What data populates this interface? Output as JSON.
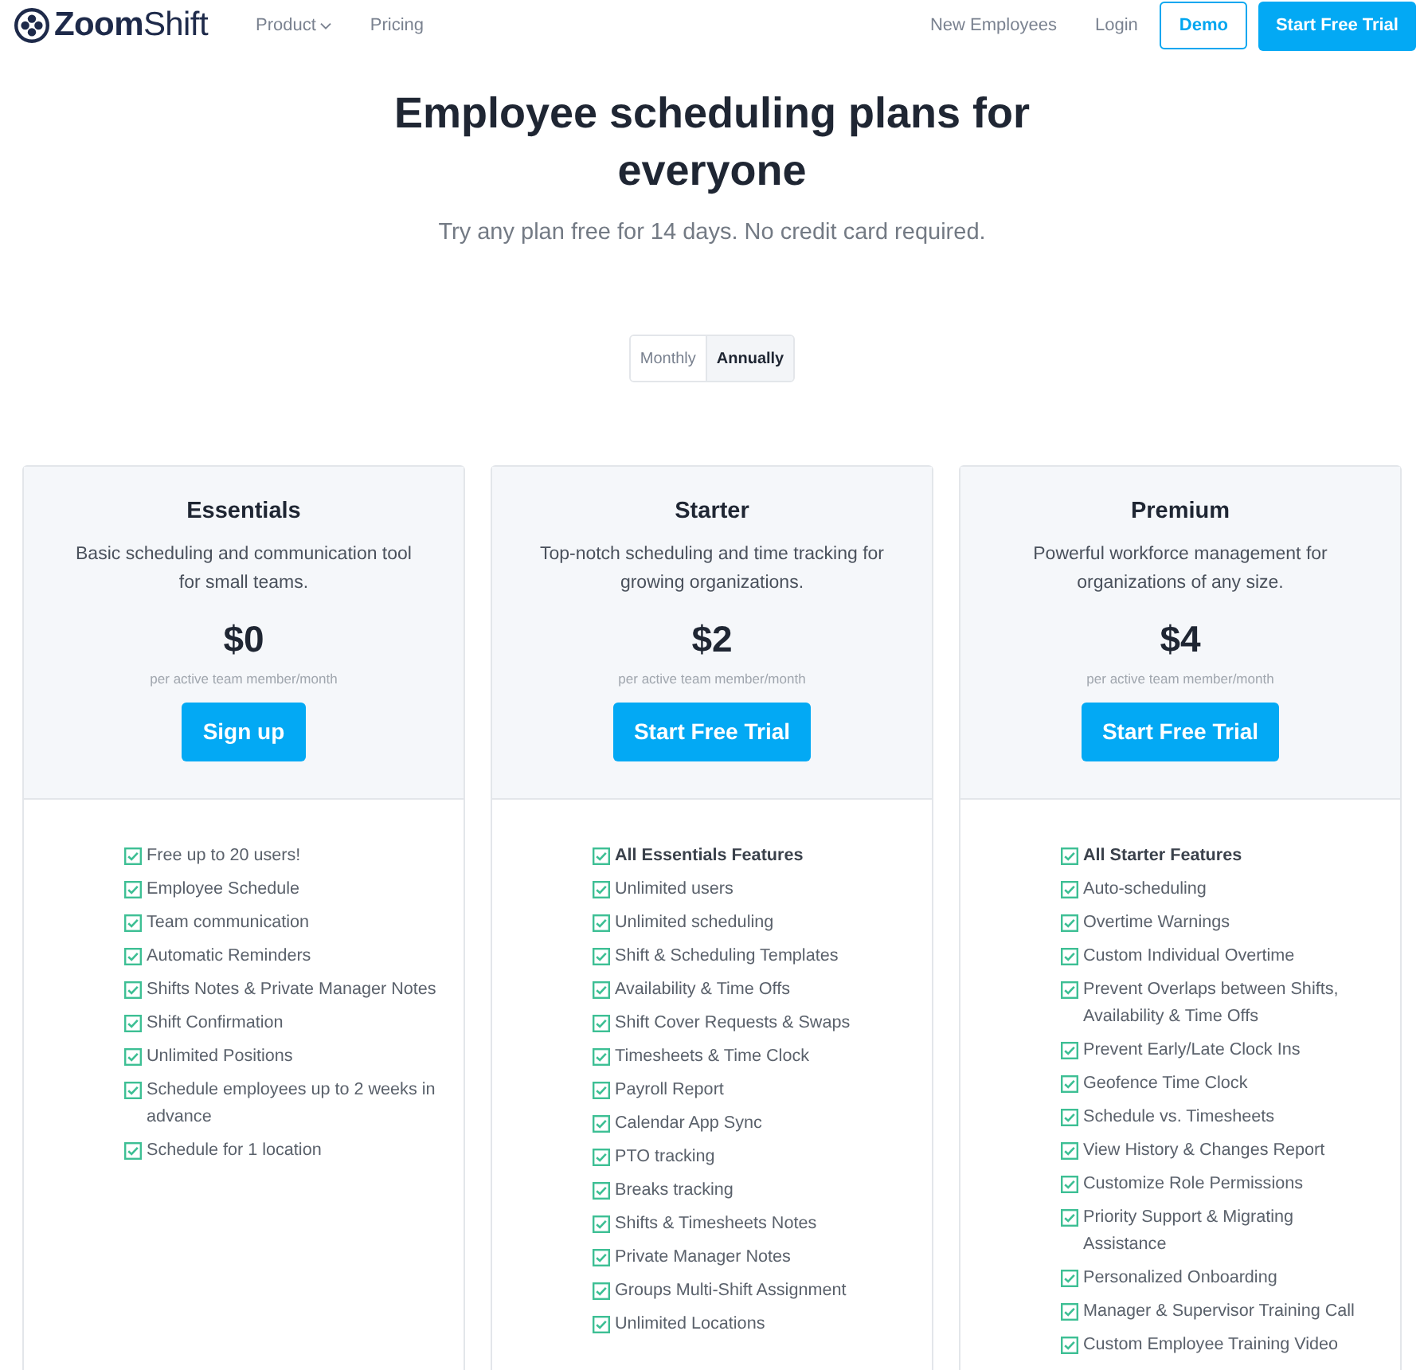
{
  "nav": {
    "logo": "**Zoom**Shift",
    "links": [
      {
        "label": "Product",
        "kind": "dropdown"
      },
      {
        "label": "Pricing",
        "kind": "link"
      }
    ],
    "right_links": [
      "New Employees",
      "Login"
    ],
    "buttons": [
      {
        "label": "Demo",
        "kind": "outline"
      },
      {
        "label": "Start Free Trial",
        "kind": "filled"
      }
    ]
  },
  "hero": {
    "title": "Employee scheduling plans for everyone",
    "subtitle": "Try any plan free for 14 days. No credit card required."
  },
  "billing_toggle": [
    {
      "label": "Monthly",
      "selected": false
    },
    {
      "label": "Annually",
      "selected": true
    }
  ],
  "plans": [
    {
      "name": "Essentials",
      "description": "Basic scheduling and communication tool for small teams.",
      "price": "$0",
      "price_note": "per active team member/month",
      "button": "Sign up",
      "features": [
        "Free up to 20 users!",
        "Employee Schedule",
        "Team communication",
        "Automatic Reminders",
        "Shifts Notes & Private Manager Notes",
        "Shift Confirmation",
        "Unlimited Positions",
        "Schedule employees up to 2 weeks in advance",
        "Schedule for 1 location"
      ]
    },
    {
      "name": "Starter",
      "description": "Top-notch scheduling and time tracking for growing organizations.",
      "price": "$2",
      "price_note": "per active team member/month",
      "button": "Start Free Trial",
      "inherits": "All Essentials Features",
      "features": [
        "Unlimited users",
        "Unlimited scheduling",
        "Shift & Scheduling Templates",
        "Availability & Time Offs",
        "Shift Cover Requests & Swaps",
        "Timesheets & Time Clock",
        "Payroll Report",
        "Calendar App Sync",
        "PTO tracking",
        "Breaks tracking",
        "Shifts & Timesheets Notes",
        "Private Manager Notes",
        "Groups Multi-Shift Assignment",
        "Unlimited Locations"
      ]
    },
    {
      "name": "Premium",
      "description": "Powerful workforce management for organizations of any size.",
      "price": "$4",
      "price_note": "per active team member/month",
      "button": "Start Free Trial",
      "inherits": "All Starter Features",
      "features": [
        "Auto-scheduling",
        "Overtime Warnings",
        "Custom Individual Overtime",
        "Prevent Overlaps between Shifts, Availability & Time Offs",
        "Prevent Early/Late Clock Ins",
        "Geofence Time Clock",
        "Schedule vs. Timesheets",
        "View History & Changes Report",
        "Customize Role Permissions",
        "Priority Support & Migrating Assistance",
        "Personalized Onboarding",
        "Manager & Supervisor Training Call",
        "Custom Employee Training Video"
      ]
    }
  ]
}
